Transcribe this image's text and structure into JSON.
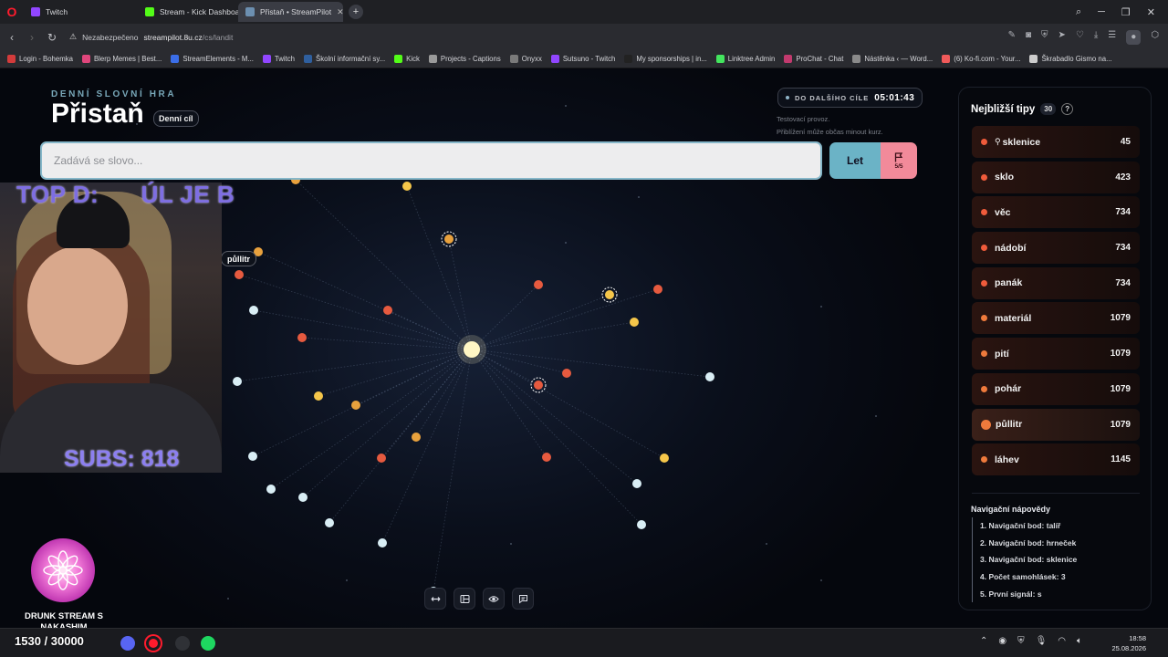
{
  "browser": {
    "tabs": [
      {
        "label": "Twitch",
        "color": "#9146ff"
      },
      {
        "label": "Stream - Kick Dashboard",
        "color": "#53fc18"
      },
      {
        "label": "Přistaň • StreamPilot",
        "color": "#6c8fb0"
      }
    ],
    "security_label": "Nezabezpečeno",
    "url_host": "streampilot.8u.cz",
    "url_path": "/cs/landit",
    "bookmarks": [
      {
        "label": "Login - Bohemka",
        "color": "#d33b3b"
      },
      {
        "label": "Blerp Memes | Best...",
        "color": "#e0467c"
      },
      {
        "label": "StreamElements - M...",
        "color": "#3b6ee8"
      },
      {
        "label": "Twitch",
        "color": "#9146ff"
      },
      {
        "label": "Školní informační sy...",
        "color": "#2f5f9e"
      },
      {
        "label": "Kick",
        "color": "#53fc18"
      },
      {
        "label": "Projects - Captions",
        "color": "#9a9a9a"
      },
      {
        "label": "Onyxx",
        "color": "#7a7a7a"
      },
      {
        "label": "Sutsuno - Twitch",
        "color": "#9146ff"
      },
      {
        "label": "My sponsorships | in...",
        "color": "#222222"
      },
      {
        "label": "Linktree Admin",
        "color": "#43e55e"
      },
      {
        "label": "ProChat - Chat",
        "color": "#c23a6e"
      },
      {
        "label": "Nástěnka ‹ — Word...",
        "color": "#8a8a8a"
      },
      {
        "label": "(6) Ko-fi.com - Your...",
        "color": "#f05a5a"
      },
      {
        "label": "Škrabadlo Gismo na...",
        "color": "#cccccc"
      }
    ]
  },
  "game": {
    "kicker": "DENNÍ SLOVNÍ HRA",
    "title": "Přistaň",
    "mode_badge": "Denní cíl",
    "timer_label": "DO DALŠÍHO CÍLE",
    "timer_value": "05:01:43",
    "test_note_line1": "Testovací provoz.",
    "test_note_line2": "Přiblížení může občas minout kurz.",
    "input_placeholder": "Zadává se slovo...",
    "submit_label": "Let",
    "flag_count": "5/5",
    "hovered_node_label": "půllitr",
    "node_colors": {
      "red": "#e65a3f",
      "orange": "#e8a13d",
      "yellow": "#f5c64a",
      "white": "#d9eef5",
      "center": "#fff6c4"
    }
  },
  "panel": {
    "title": "Nejbližší tipy",
    "count": "30",
    "help": "?",
    "tips": [
      {
        "word": "sklenice",
        "rank": "45",
        "pinned": true
      },
      {
        "word": "sklo",
        "rank": "423"
      },
      {
        "word": "věc",
        "rank": "734"
      },
      {
        "word": "nádobí",
        "rank": "734"
      },
      {
        "word": "panák",
        "rank": "734"
      },
      {
        "word": "materiál",
        "rank": "1079"
      },
      {
        "word": "pití",
        "rank": "1079"
      },
      {
        "word": "pohár",
        "rank": "1079"
      },
      {
        "word": "půllitr",
        "rank": "1079",
        "highlight": true
      },
      {
        "word": "láhev",
        "rank": "1145"
      }
    ],
    "nav_title": "Navigační nápovědy",
    "nav_items": [
      "1. Navigační bod: talíř",
      "2. Navigační bod: hrneček",
      "3. Navigační bod: sklenice",
      "4. Počet samohlásek: 3",
      "5. První signál: s"
    ]
  },
  "overlay": {
    "top_text": "TOP D:      ÚL JE B",
    "subs_text": "SUBS: 818",
    "stream_title": "DRUNK STREAM S NAKASHIM",
    "sub_goal": "1530 / 30000"
  },
  "taskbar": {
    "time": "18:58",
    "date": "25.08.2026"
  }
}
